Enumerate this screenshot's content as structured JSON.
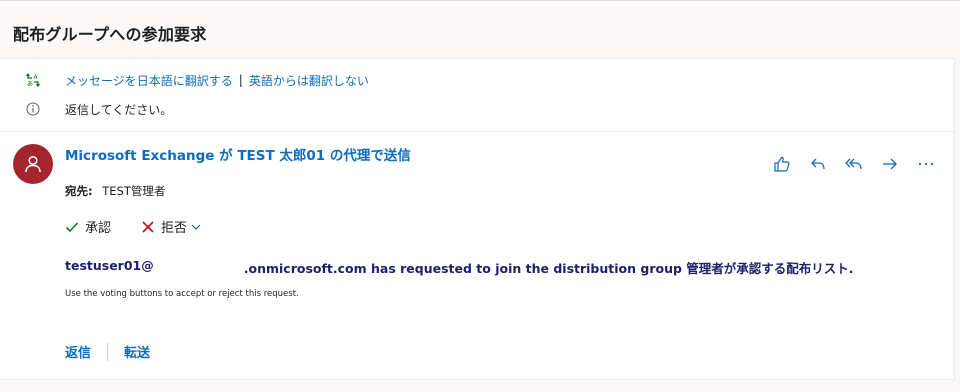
{
  "subject": "配布グループへの参加要求",
  "translation": {
    "translate_link": "メッセージを日本語に翻訳する",
    "separator": "|",
    "never_translate_link": "英語からは翻訳しない"
  },
  "notice": {
    "text": "返信してください。"
  },
  "message": {
    "sender": "Microsoft Exchange が TEST 太郎01 の代理で送信",
    "to_label": "宛先:",
    "to_value": "TEST管理者",
    "vote": {
      "approve": "承認",
      "reject": "拒否"
    },
    "body_prefix": "testuser01@",
    "body_suffix": ".onmicrosoft.com has requested to join the distribution group 管理者が承認する配布リスト.",
    "body_small": "Use the voting buttons to accept or reject this request."
  },
  "footer": {
    "reply": "返信",
    "forward": "転送"
  },
  "colors": {
    "accent": "#0f6cbd",
    "avatar": "#a4262c",
    "approve": "#107c10",
    "reject": "#c50f1f",
    "body_text": "#1f1f6b"
  },
  "icons": {
    "translate": "translate-icon",
    "info": "info-icon",
    "avatar": "person-icon",
    "like": "thumbs-up-icon",
    "reply": "reply-icon",
    "reply_all": "reply-all-icon",
    "forward": "forward-icon",
    "more": "more-icon",
    "approve": "checkmark-icon",
    "reject": "dismiss-icon",
    "dropdown": "chevron-down-icon"
  }
}
